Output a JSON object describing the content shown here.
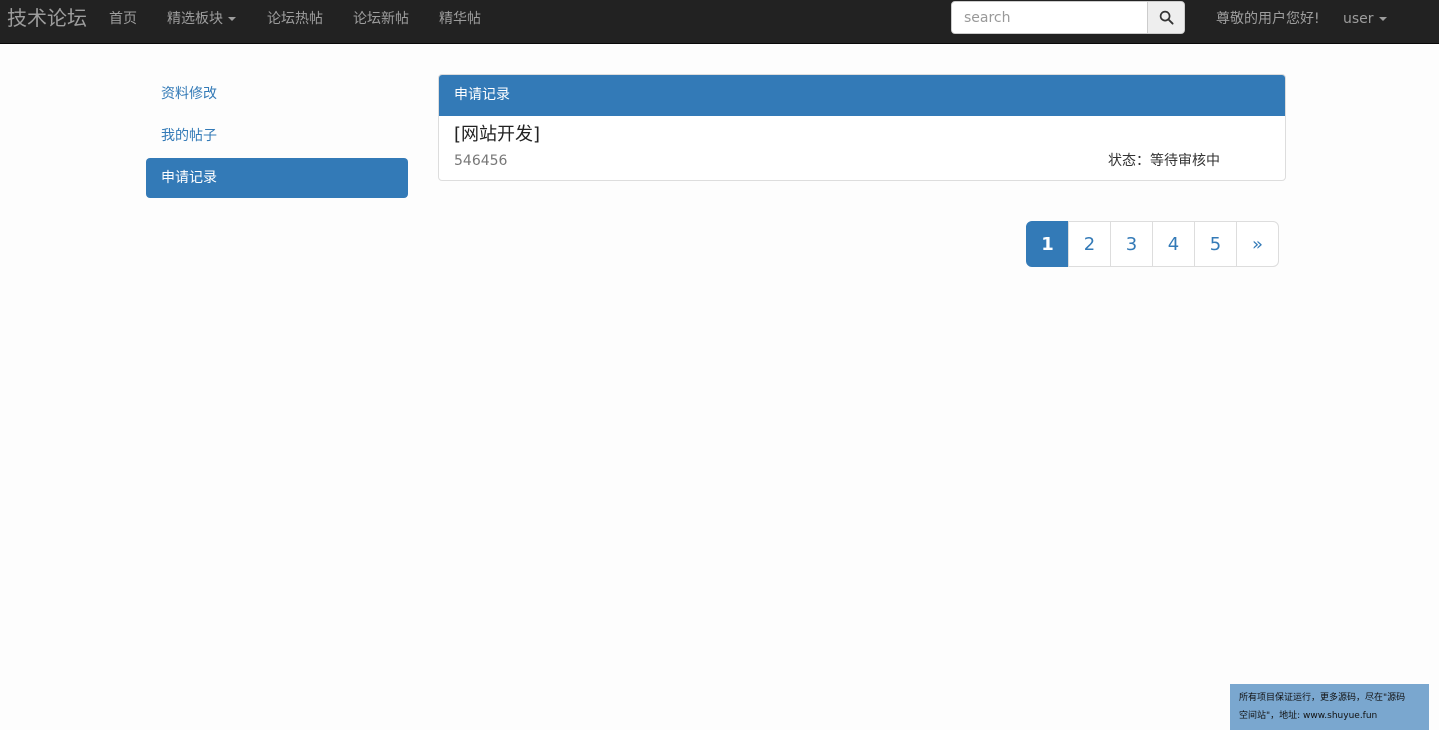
{
  "navbar": {
    "brand": "技术论坛",
    "links": {
      "home": "首页",
      "boards": "精选板块",
      "hot": "论坛热帖",
      "new": "论坛新帖",
      "featured": "精华帖"
    },
    "search": {
      "placeholder": "search",
      "value": ""
    },
    "greeting": "尊敬的用户您好!",
    "user": "user"
  },
  "sidebar": {
    "items": [
      {
        "label": "资料修改"
      },
      {
        "label": "我的帖子"
      },
      {
        "label": "申请记录",
        "active": true
      }
    ]
  },
  "panel": {
    "heading": "申请记录",
    "record": {
      "title": "[网站开发]",
      "id": "546456",
      "status": "状态：等待审核中"
    }
  },
  "pagination": {
    "pages": [
      "1",
      "2",
      "3",
      "4",
      "5"
    ],
    "current": "1",
    "next": "»"
  },
  "watermark": {
    "line1": "所有项目保证运行，更多源码，尽在\"源码",
    "line2": "空间站\"，地址: www.shuyue.fun"
  },
  "colors": {
    "navbar_bg": "#222222",
    "accent": "#337ab7"
  }
}
